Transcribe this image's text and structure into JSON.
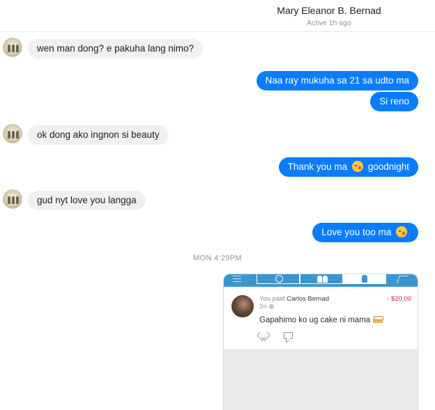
{
  "header": {
    "contact_name": "Mary Eleanor B. Bernad",
    "status": "Active 1h ago"
  },
  "messages": [
    {
      "from": "contact",
      "text": "wen man dong? e pakuha lang nimo?"
    },
    {
      "from": "me",
      "text": "Naa ray mukuha sa 21 sa udto ma"
    },
    {
      "from": "me",
      "text": "Si reno"
    },
    {
      "from": "contact",
      "text": "ok dong ako ingnon si beauty"
    },
    {
      "from": "me",
      "text": "Thank you ma",
      "text_after": "goodnight",
      "emoji": "kissing-face-emoji"
    },
    {
      "from": "contact",
      "text": "gud nyt love you langga"
    },
    {
      "from": "me",
      "text": "Love you too ma",
      "emoji": "kissing-face-emoji"
    }
  ],
  "timestamp": "MON 4:29PM",
  "attachment": {
    "nav_icons": [
      "menu-icon",
      "globe-icon",
      "friends-icon",
      "person-icon",
      "expand-icon"
    ],
    "nav_active_tab": "person-icon",
    "payer_label": "You paid",
    "payee": "Carlos Bernad",
    "amount": "- $20.00",
    "time_ago": "3m",
    "note": "Gapahimo ko ug cake ni mama",
    "note_emoji": "cake-emoji",
    "actions": [
      "like-icon",
      "comment-icon"
    ]
  },
  "colors": {
    "outgoing_bubble": "#0a7cff",
    "incoming_bubble": "#f0f0f0",
    "venmo_blue": "#3d95ce",
    "amount_red": "#d2283e"
  }
}
